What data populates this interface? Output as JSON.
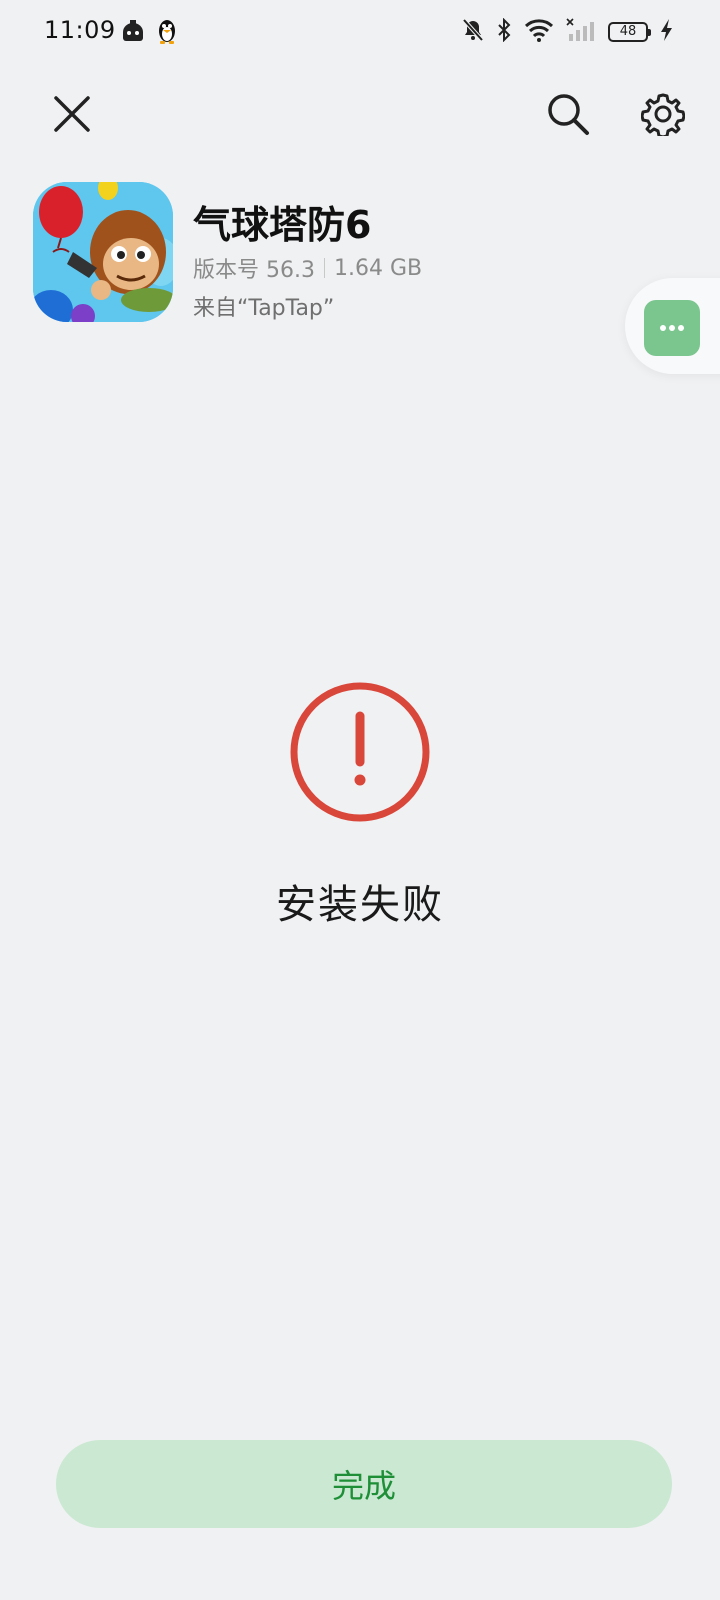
{
  "status_bar": {
    "time": "11:09",
    "battery": "48",
    "icons": [
      "messenger-bot-icon",
      "qq-penguin-icon",
      "mute-bell-icon",
      "bluetooth-icon",
      "wifi-icon",
      "cell-signal-off-icon",
      "battery-icon",
      "charging-icon"
    ]
  },
  "toolbar": {
    "icons": [
      "close-icon",
      "search-icon",
      "gear-icon"
    ]
  },
  "app": {
    "name": "气球塔防6",
    "version": "版本号 56.3",
    "size": "1.64 GB",
    "source": "来自“TapTap”"
  },
  "status": {
    "title": "安装失败",
    "icon": "error-exclamation-icon",
    "color": "#d9463a"
  },
  "actions": {
    "done_label": "完成"
  },
  "colors": {
    "background": "#f0f1f3",
    "accent_green": "#1e8f37",
    "button_bg": "#cbe8d2",
    "float_btn": "#7bc58f"
  }
}
